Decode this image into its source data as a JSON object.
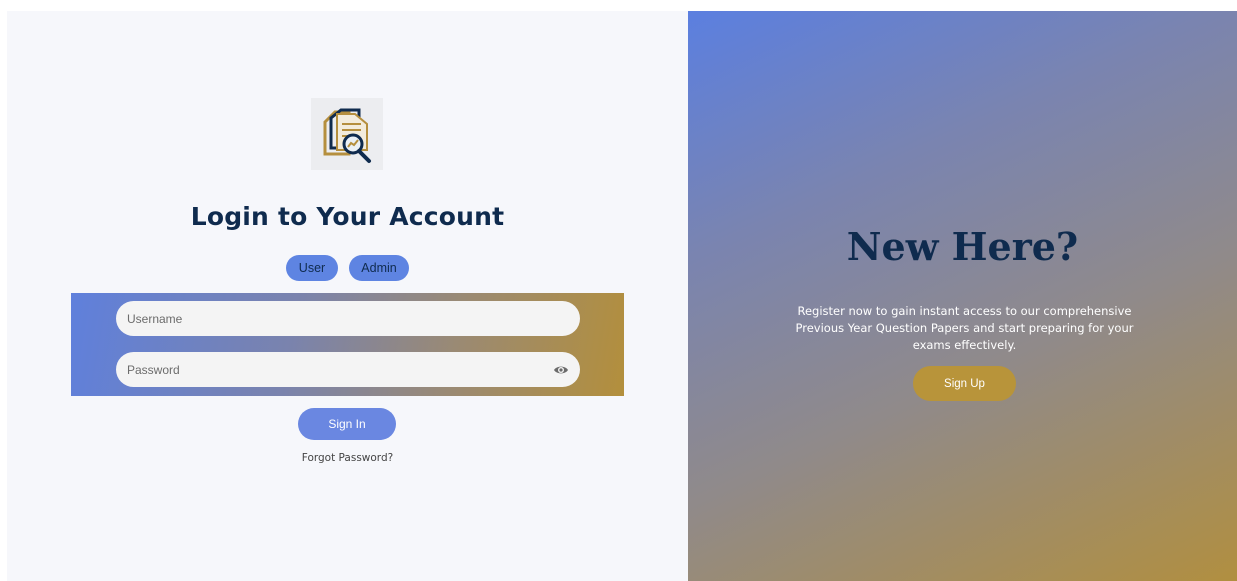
{
  "login": {
    "logo_icon": "document-search-logo-icon",
    "title": "Login to Your Account",
    "roles": [
      {
        "label": "User"
      },
      {
        "label": "Admin"
      }
    ],
    "username_placeholder": "Username",
    "password_placeholder": "Password",
    "password_toggle_icon": "eye-icon",
    "signin_label": "Sign In",
    "forgot_label": "Forgot Password?"
  },
  "register": {
    "title": "New Here?",
    "text": "Register now to gain instant access to our comprehensive Previous Year Question Papers and start preparing for your exams effectively.",
    "signup_label": "Sign Up"
  },
  "colors": {
    "primary_blue": "#5e84e2",
    "gold": "#b8943a",
    "navy_text": "#0f2b4e",
    "panel_bg": "#f6f7fb"
  }
}
